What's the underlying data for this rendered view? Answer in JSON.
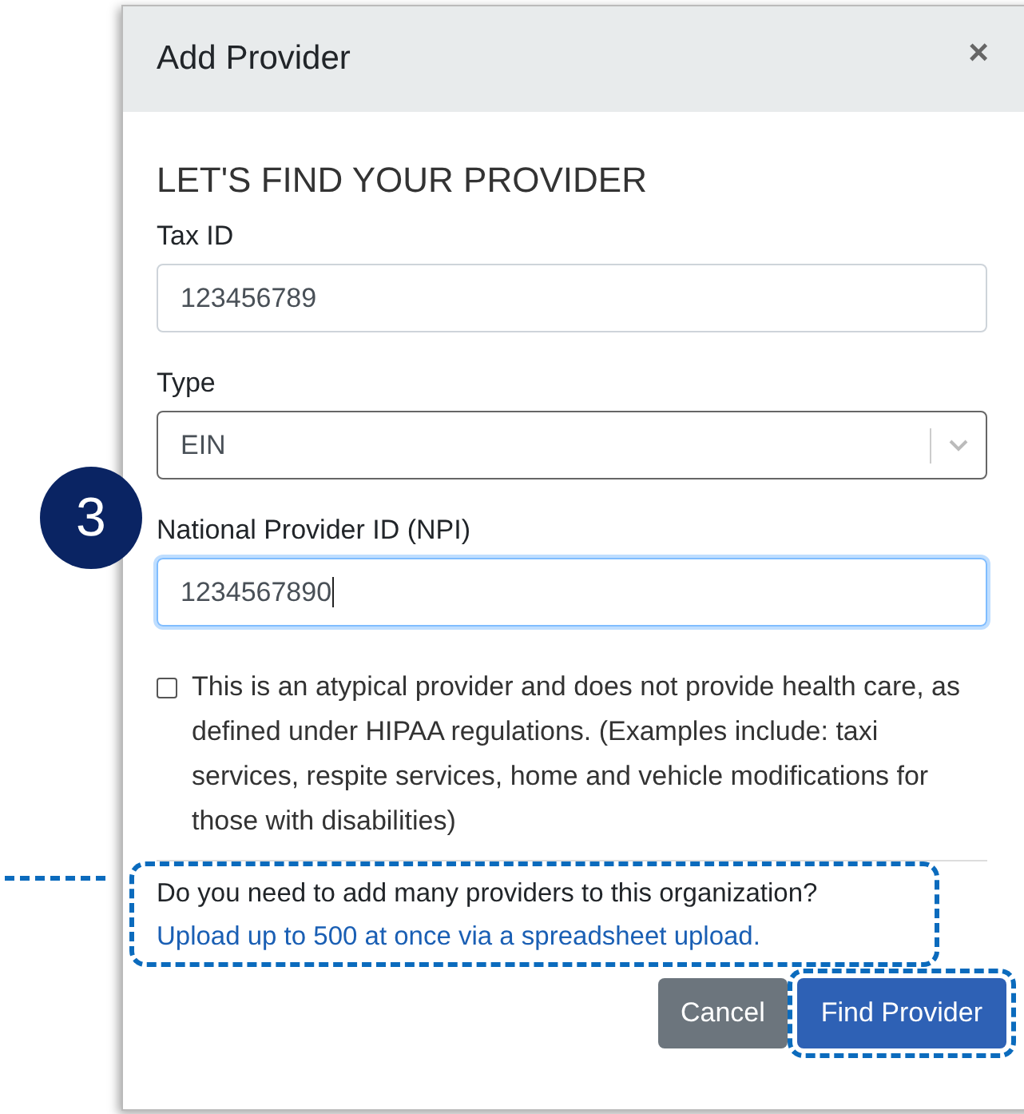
{
  "dialog": {
    "title": "Add Provider",
    "close": "×"
  },
  "heading": "LET'S FIND YOUR PROVIDER",
  "fields": [
    {
      "kind": "text",
      "label": "Tax ID",
      "value": "123456789",
      "focused": false
    },
    {
      "kind": "select",
      "label": "Type",
      "value": "EIN",
      "focused": false
    },
    {
      "kind": "text",
      "label": "National Provider ID (NPI)",
      "value": "1234567890",
      "focused": true
    }
  ],
  "atypical": {
    "checked": false,
    "label": "This is an atypical provider and does not provide health care, as defined under HIPAA regulations. (Examples include: taxi services, respite services, home and vehicle modifications for those with disabilities)"
  },
  "bulk": {
    "question": "Do you need to add many providers to this organization?",
    "link": "Upload up to 500 at once via a spreadsheet upload."
  },
  "buttons": [
    {
      "label": "Cancel",
      "kind": "secondary"
    },
    {
      "label": "Find Provider",
      "kind": "primary"
    }
  ],
  "annotation": {
    "step": "3"
  }
}
